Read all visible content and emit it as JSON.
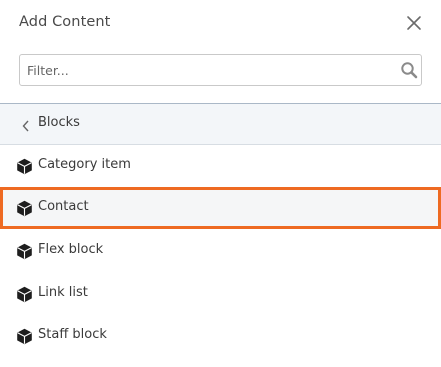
{
  "header": {
    "title": "Add Content",
    "close_icon": "close-icon"
  },
  "search": {
    "placeholder": "Filter...",
    "value": "",
    "icon": "search-icon"
  },
  "breadcrumb": {
    "icon": "chevron-left-icon",
    "label": "Blocks"
  },
  "items": [
    {
      "label": "Category item",
      "icon": "block-cube-icon",
      "selected": false
    },
    {
      "label": "Contact",
      "icon": "block-cube-icon",
      "selected": true
    },
    {
      "label": "Flex block",
      "icon": "block-cube-icon",
      "selected": false
    },
    {
      "label": "Link list",
      "icon": "block-cube-icon",
      "selected": false
    },
    {
      "label": "Staff block",
      "icon": "block-cube-icon",
      "selected": false
    }
  ],
  "colors": {
    "highlight": "#ee6a22",
    "breadcrumb_bg": "#f3f6f9"
  }
}
